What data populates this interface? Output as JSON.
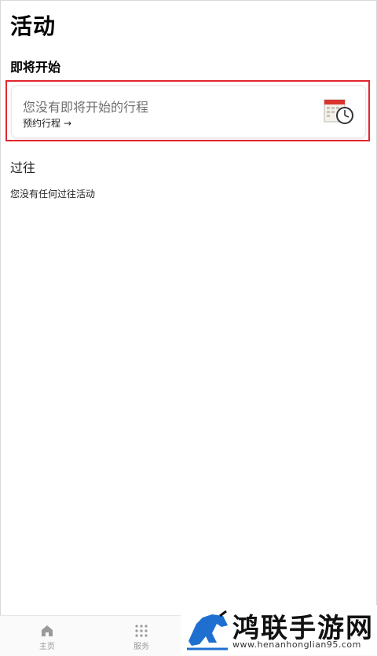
{
  "header": {
    "title": "活动"
  },
  "upcoming": {
    "section_title": "即将开始",
    "empty_message": "您没有即将开始的行程",
    "book_link_label": "预约行程",
    "book_link_arrow": "→",
    "illustration_icon": "calendar-clock-icon"
  },
  "past": {
    "section_title": "过往",
    "empty_message": "您没有任何过往活动"
  },
  "tabbar": {
    "items": [
      {
        "label": "主页",
        "icon": "home-icon"
      },
      {
        "label": "服务",
        "icon": "grid-icon"
      }
    ]
  },
  "watermark": {
    "title": "鸿联手游网",
    "url": "www.henanhonglian95.com"
  },
  "colors": {
    "highlight_border": "#e0262d",
    "muted_text": "#6f6f6f",
    "tab_inactive": "#9a9a9a",
    "watermark_blue": "#1e6fd0"
  }
}
